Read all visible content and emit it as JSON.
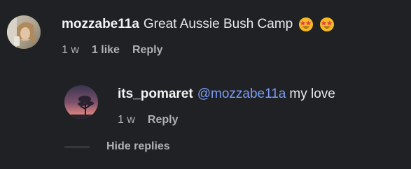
{
  "comments": [
    {
      "username": "mozzabe11a",
      "text": "Great Aussie Bush Camp",
      "emojis": [
        "star-struck-emoji",
        "star-struck-emoji"
      ],
      "time": "1 w",
      "likes": "1 like",
      "reply_label": "Reply"
    },
    {
      "username": "its_pomaret",
      "mention": "@mozzabe11a",
      "text": "my love",
      "time": "1 w",
      "reply_label": "Reply"
    }
  ],
  "hide_replies_label": "Hide replies",
  "colors": {
    "background": "#202124",
    "mention": "#7b9cf3",
    "meta_text": "#aeb1b6"
  }
}
